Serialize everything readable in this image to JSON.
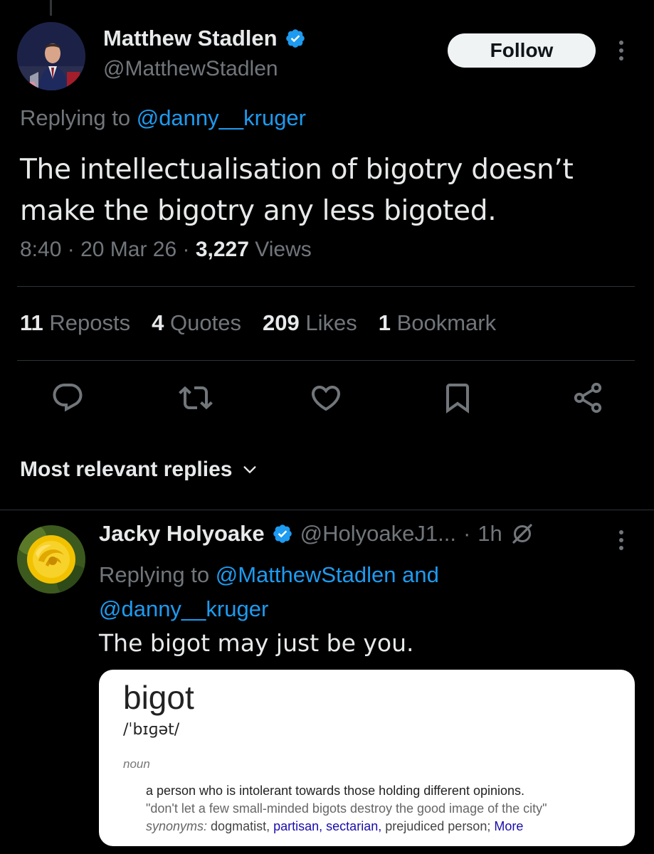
{
  "main_tweet": {
    "author": {
      "name": "Matthew Stadlen",
      "handle": "@MatthewStadlen",
      "verified_icon": "verified-badge-icon"
    },
    "follow_label": "Follow",
    "replying_prefix": "Replying to",
    "replying_to": "@danny__kruger",
    "text": "The intellectualisation of bigotry doesn’t make the bigotry any less bigoted.",
    "time": "8:40",
    "sep1": "·",
    "date": "20 Mar 26",
    "sep2": "·",
    "views_count": "3,227",
    "views_label": "Views",
    "stats": {
      "reposts_count": "11",
      "reposts_label": "Reposts",
      "quotes_count": "4",
      "quotes_label": "Quotes",
      "likes_count": "209",
      "likes_label": "Likes",
      "bookmarks_count": "1",
      "bookmarks_label": "Bookmark"
    },
    "action_icons": [
      "reply-icon",
      "repost-icon",
      "like-icon",
      "bookmark-icon",
      "share-icon"
    ]
  },
  "replies_header": {
    "label": "Most relevant replies",
    "icon": "chevron-down-icon"
  },
  "reply": {
    "name": "Jacky Holyoake",
    "handle": "@HolyoakeJ1...",
    "dot": "·",
    "age": "1h",
    "grok_icon": "grok-icon",
    "replying_prefix": "Replying to",
    "replying_to_1": "@MatthewStadlen",
    "and": "and",
    "replying_to_2": "@danny__kruger",
    "text": "The bigot may just be you.",
    "media": {
      "word": "bigot",
      "phonetic": "/ˈbɪɡət/",
      "pos": "noun",
      "definition": "a person who is intolerant towards those holding different opinions.",
      "example": "\"don't let a few small-minded bigots destroy the good image of the city\"",
      "synonyms_label": "synonyms:",
      "syn1": "dogmatist,",
      "syn2": "partisan,",
      "syn3": "sectarian,",
      "syn4": "prejudiced person;",
      "more": "More"
    }
  },
  "colors": {
    "background": "#000000",
    "text": "#e7e9ea",
    "muted": "#71767b",
    "link": "#1d9bf0",
    "verified": "#1d9bf0",
    "divider": "#2f3336"
  }
}
